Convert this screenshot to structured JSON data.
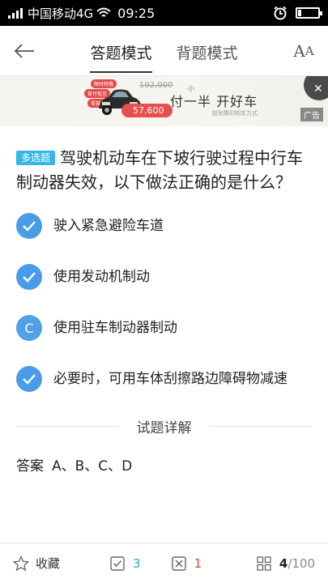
{
  "status_bar": {
    "carrier": "中国移动4G",
    "time": "09:25",
    "battery_level": 0.15
  },
  "nav": {
    "tabs": [
      {
        "label": "答题模式",
        "active": true
      },
      {
        "label": "背题模式",
        "active": false
      }
    ],
    "font_button_big": "A",
    "font_button_small": "A"
  },
  "ad": {
    "tags": [
      "限时特惠",
      "首付低至",
      "零首付"
    ],
    "old_price": "192,000",
    "new_price": "57,600",
    "title": "付一半 开好车",
    "title_small": "小",
    "subtitle": "超划算的购车方式",
    "label": "广告",
    "close": "✕"
  },
  "question": {
    "type": "多选题",
    "text": "驾驶机动车在下坡行驶过程中行车制动器失效，以下做法正确的是什么？"
  },
  "options": [
    {
      "marker": "check",
      "text": "驶入紧急避险车道"
    },
    {
      "marker": "check",
      "text": "使用发动机制动"
    },
    {
      "marker": "C",
      "text": "使用驻车制动器制动"
    },
    {
      "marker": "check",
      "text": "必要时，可用车体刮擦路边障碍物减速"
    }
  ],
  "detail": {
    "label": "试题详解",
    "answer_key": "答案",
    "answer_value": "A、B、C、D"
  },
  "bottom_bar": {
    "favorite": "收藏",
    "right_count": "3",
    "wrong_count": "1",
    "current": "4",
    "total": "/100"
  },
  "colors": {
    "accent_blue": "#4a9ce8",
    "type_badge": "#39b6e8",
    "right": "#2aa7c8",
    "wrong": "#e04444"
  }
}
